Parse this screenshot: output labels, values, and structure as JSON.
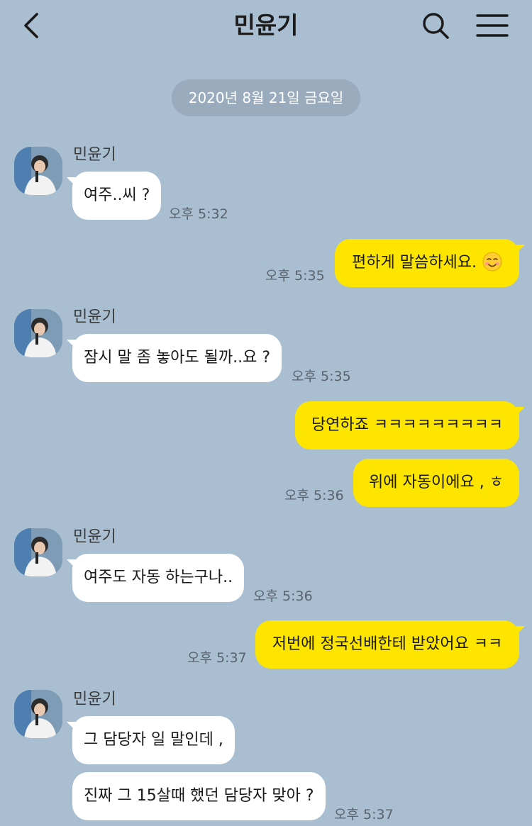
{
  "header": {
    "title": "민윤기",
    "icons": {
      "back": "chevron-left-icon",
      "search": "search-icon",
      "menu": "hamburger-menu-icon"
    }
  },
  "date_divider": "2020년 8월 21일 금요일",
  "colors": {
    "background": "#aabed2",
    "outgoing_bubble": "#fee500",
    "incoming_bubble": "#ffffff",
    "date_pill": "#99abbd"
  },
  "messages": [
    {
      "direction": "in",
      "sender": "민윤기",
      "text": "여주..씨 ?",
      "time": "오후 5:32"
    },
    {
      "direction": "out",
      "text": "편하게 말씀하세요.",
      "emoji": "smiling-face-emoji",
      "time": "오후 5:35"
    },
    {
      "direction": "in",
      "sender": "민윤기",
      "text": "잠시 말 좀 놓아도 될까..요 ?",
      "time": "오후 5:35"
    },
    {
      "direction": "out",
      "text": "당연하죠 ㅋㅋㅋㅋㅋㅋㅋㅋㅋ",
      "time": ""
    },
    {
      "direction": "out",
      "text": "위에 자동이에요 , ㅎ",
      "time": "오후 5:36"
    },
    {
      "direction": "in",
      "sender": "민윤기",
      "text": "여주도 자동 하는구나..",
      "time": "오후 5:36"
    },
    {
      "direction": "out",
      "text": "저번에 정국선배한테 받았어요 ㅋㅋ",
      "time": "오후 5:37"
    },
    {
      "direction": "in",
      "sender": "민윤기",
      "text": "그 담당자 일 말인데 ,",
      "time": ""
    },
    {
      "direction": "in",
      "text": "진짜 그 15살때 했던 담당자 맞아 ?",
      "time": "오후 5:37"
    }
  ]
}
